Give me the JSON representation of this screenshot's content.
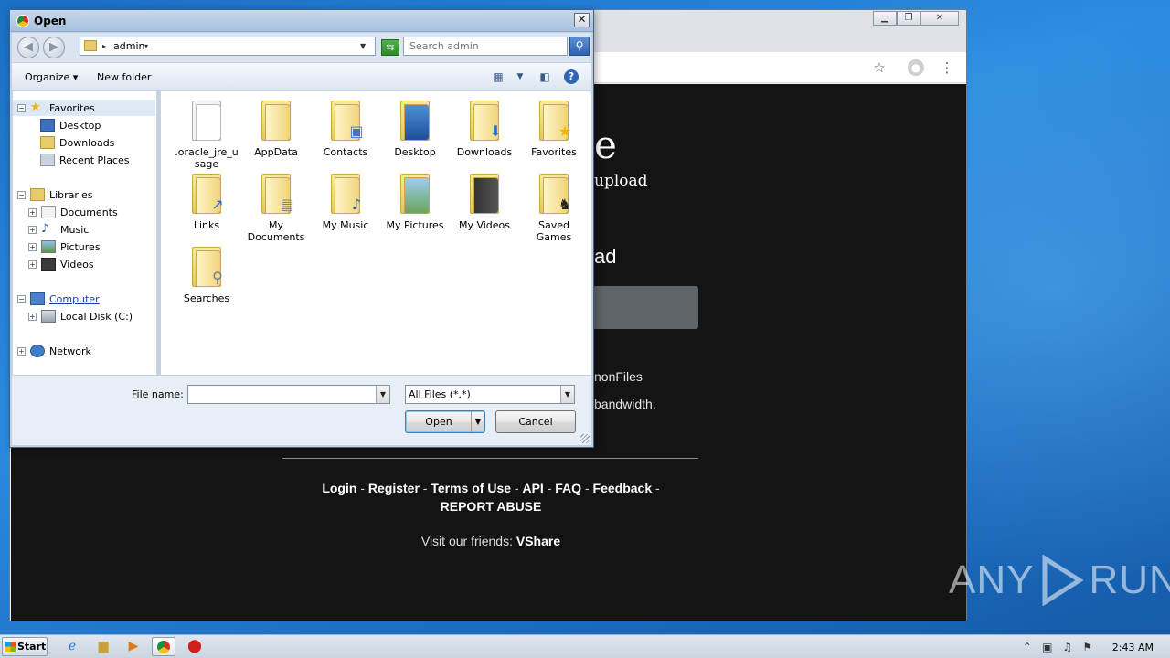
{
  "dialog": {
    "title": "Open",
    "address_path": "admin",
    "search_placeholder": "Search admin",
    "toolbar": {
      "organize": "Organize",
      "new_folder": "New folder"
    },
    "nav": {
      "favorites": "Favorites",
      "desktop": "Desktop",
      "downloads": "Downloads",
      "recent_places": "Recent Places",
      "libraries": "Libraries",
      "documents": "Documents",
      "music": "Music",
      "pictures": "Pictures",
      "videos": "Videos",
      "computer": "Computer",
      "local_disk": "Local Disk (C:)",
      "network": "Network"
    },
    "files": [
      {
        "name": ".oracle_jre_u\nsage",
        "icon": "blank-doc-icon"
      },
      {
        "name": "AppData",
        "icon": "folder-icon"
      },
      {
        "name": "Contacts",
        "icon": "contacts-icon"
      },
      {
        "name": "Desktop",
        "icon": "desktop-icon"
      },
      {
        "name": "Downloads",
        "icon": "download-arrow-icon"
      },
      {
        "name": "Favorites",
        "icon": "star-icon"
      },
      {
        "name": "Links",
        "icon": "link-arrow-icon"
      },
      {
        "name": "My\nDocuments",
        "icon": "documents-icon"
      },
      {
        "name": "My Music",
        "icon": "music-note-icon"
      },
      {
        "name": "My Pictures",
        "icon": "picture-icon"
      },
      {
        "name": "My Videos",
        "icon": "film-icon"
      },
      {
        "name": "Saved\nGames",
        "icon": "chess-piece-icon"
      },
      {
        "name": "Searches",
        "icon": "magnifier-icon"
      }
    ],
    "file_name_label": "File name:",
    "file_name_value": "",
    "filter": "All Files (*.*)",
    "open_button": "Open",
    "cancel_button": "Cancel"
  },
  "page": {
    "title_fragment": "e",
    "subtitle_fragment": "upload",
    "upload_fragment": "ad",
    "info_line_1": "nonFiles",
    "info_line_2": "bandwidth.",
    "footer_links": [
      "Login",
      "Register",
      "Terms of Use",
      "API",
      "FAQ",
      "Feedback",
      "REPORT ABUSE"
    ],
    "friends_text": "Visit our friends:",
    "friends_link": "VShare",
    "watermark_left": "ANY",
    "watermark_right": "RUN"
  },
  "taskbar": {
    "start_label": "Start",
    "clock": "2:43 AM"
  },
  "colors": {
    "page_bg": "#141414",
    "dialog_frame": "#c3d1e2",
    "desktop_bg": "#1a6fc4"
  }
}
